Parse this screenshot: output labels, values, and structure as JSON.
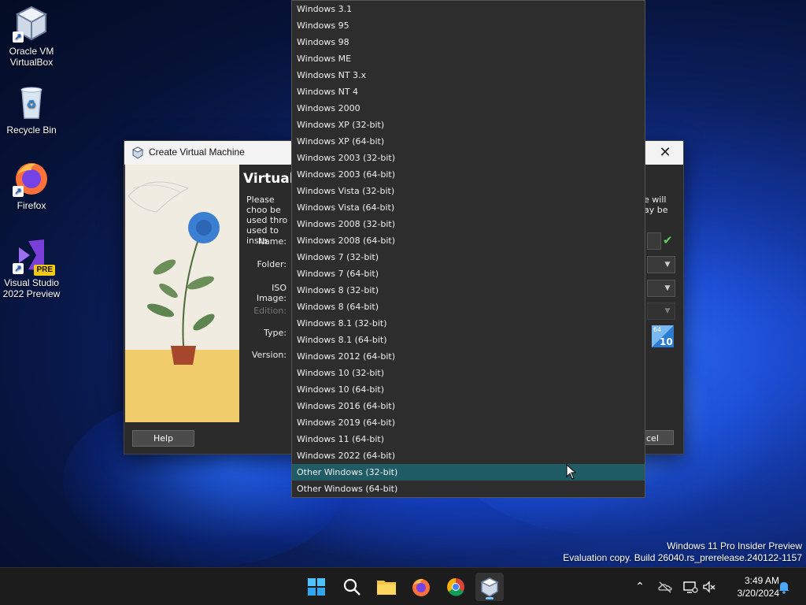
{
  "desktop": {
    "icons": [
      {
        "label": "Oracle VM VirtualBox",
        "icon": "virtualbox-icon"
      },
      {
        "label": "Recycle Bin",
        "icon": "recycle-bin-icon"
      },
      {
        "label": "Firefox",
        "icon": "firefox-icon"
      },
      {
        "label": "Visual Studio 2022 Preview",
        "icon": "visual-studio-icon",
        "badge": "PRE"
      }
    ]
  },
  "dialog": {
    "title": "Create Virtual Machine",
    "heading": "Virtual",
    "description_left": "Please choo be used thro used to insta",
    "description_right": "e will ay be",
    "fields": {
      "name": "Name:",
      "folder": "Folder:",
      "iso_image": "ISO Image:",
      "edition": "Edition:",
      "type": "Type:",
      "version": "Version:"
    },
    "os_badge": {
      "bits": "64",
      "number": "10"
    },
    "help_label": "Help",
    "cancel_label": "cel"
  },
  "version_dropdown": {
    "options": [
      "Windows 3.1",
      "Windows 95",
      "Windows 98",
      "Windows ME",
      "Windows NT 3.x",
      "Windows NT 4",
      "Windows 2000",
      "Windows XP (32-bit)",
      "Windows XP (64-bit)",
      "Windows 2003 (32-bit)",
      "Windows 2003 (64-bit)",
      "Windows Vista (32-bit)",
      "Windows Vista (64-bit)",
      "Windows 2008 (32-bit)",
      "Windows 2008 (64-bit)",
      "Windows 7 (32-bit)",
      "Windows 7 (64-bit)",
      "Windows 8 (32-bit)",
      "Windows 8 (64-bit)",
      "Windows 8.1 (32-bit)",
      "Windows 8.1 (64-bit)",
      "Windows 2012 (64-bit)",
      "Windows 10 (32-bit)",
      "Windows 10 (64-bit)",
      "Windows 2016 (64-bit)",
      "Windows 2019 (64-bit)",
      "Windows 11 (64-bit)",
      "Windows 2022 (64-bit)",
      "Other Windows (32-bit)",
      "Other Windows (64-bit)"
    ],
    "highlighted": "Other Windows (32-bit)",
    "highlight_color": "#1f5c66"
  },
  "watermark": {
    "line1": "Windows 11 Pro Insider Preview",
    "line2": "Evaluation copy. Build 26040.rs_prerelease.240122-1157"
  },
  "taskbar": {
    "apps": [
      "start-icon",
      "search-icon",
      "file-explorer-icon",
      "firefox-icon",
      "chrome-icon",
      "virtualbox-icon"
    ],
    "active_app": "virtualbox-icon",
    "tray": [
      "chevron-up-icon",
      "onedrive-icon",
      "network-icon",
      "volume-muted-icon",
      "notification-bell-icon"
    ],
    "time": "3:49 AM",
    "date": "3/20/2024"
  }
}
